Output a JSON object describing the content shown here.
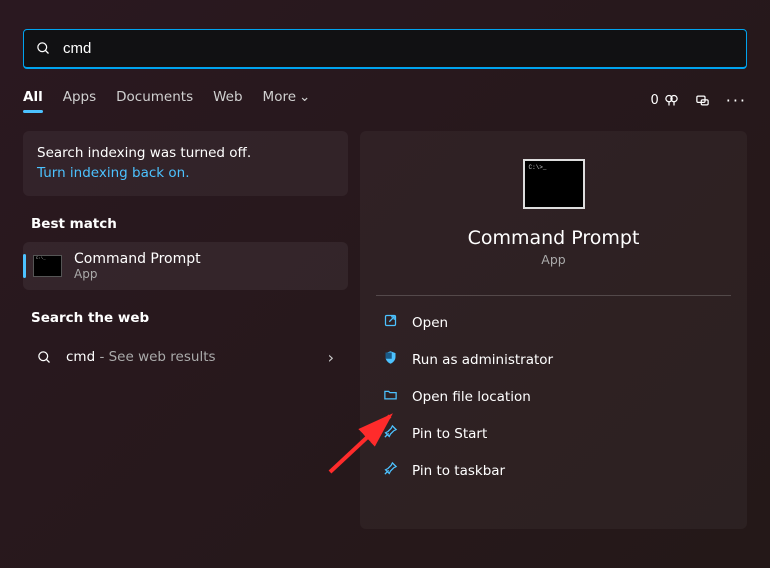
{
  "search": {
    "value": "cmd",
    "placeholder": ""
  },
  "tabs": [
    "All",
    "Apps",
    "Documents",
    "Web",
    "More"
  ],
  "active_tab": "All",
  "toolbar": {
    "count": "0"
  },
  "indexing": {
    "status": "Search indexing was turned off.",
    "link": "Turn indexing back on."
  },
  "best_match": {
    "heading": "Best match",
    "name": "Command Prompt",
    "type": "App"
  },
  "web": {
    "heading": "Search the web",
    "query": "cmd",
    "suffix": " - See web results"
  },
  "detail": {
    "title": "Command Prompt",
    "type": "App",
    "actions": [
      "Open",
      "Run as administrator",
      "Open file location",
      "Pin to Start",
      "Pin to taskbar"
    ]
  }
}
